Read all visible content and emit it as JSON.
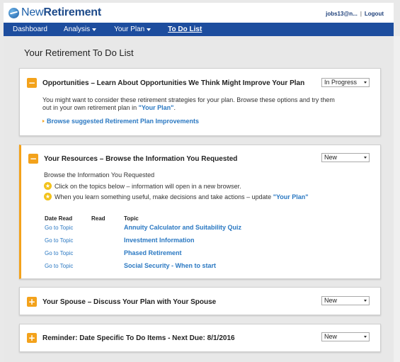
{
  "header": {
    "logo_prefix": "New",
    "logo_main": "Retirement",
    "account_user": "jobs13@n...",
    "account_sep": "|",
    "logout": "Logout"
  },
  "nav": {
    "items": [
      {
        "label": "Dashboard"
      },
      {
        "label": "Analysis"
      },
      {
        "label": "Your Plan"
      },
      {
        "label": "To Do List"
      }
    ]
  },
  "page": {
    "title": "Your Retirement To Do List"
  },
  "cards": {
    "opportunities": {
      "title": "Opportunities – Learn About Opportunities We Think Might Improve Your Plan",
      "status": "In Progress",
      "text_1": "You might want to consider these retirement strategies for your plan. Browse these options and try them",
      "text_2_prefix": "out in your own retirement plan in ",
      "text_2_link": "\"Your Plan\"",
      "text_2_suffix": ".",
      "link": "Browse suggested Retirement Plan Improvements"
    },
    "resources": {
      "title": "Your Resources – Browse the Information You Requested",
      "status": "New",
      "intro": "Browse the Information You Requested",
      "bullet_1": "Click on the topics below – information will open in a new browser.",
      "bullet_2_prefix": "When you learn something useful, make decisions and take actions – update ",
      "bullet_2_link": "\"Your Plan\"",
      "columns": [
        "Date Read",
        "Read",
        "Topic"
      ],
      "rows": [
        {
          "action": "Go to Topic",
          "topic": "Annuity Calculator and Suitability Quiz"
        },
        {
          "action": "Go to Topic",
          "topic": "Investment Information"
        },
        {
          "action": "Go to Topic",
          "topic": "Phased Retirement"
        },
        {
          "action": "Go to Topic",
          "topic": "Social Security - When to start"
        }
      ]
    },
    "spouse": {
      "title": "Your Spouse – Discuss Your Plan with Your Spouse",
      "status": "New"
    },
    "reminder": {
      "title": "Reminder: Date Specific To Do Items - Next Due: 8/1/2016",
      "status": "New"
    }
  },
  "icons": {
    "collapse": "−",
    "expand": "+",
    "star": "★"
  },
  "colors": {
    "brand": "#1d4d9e",
    "accent": "#f3a21b",
    "link": "#2a78c2"
  }
}
